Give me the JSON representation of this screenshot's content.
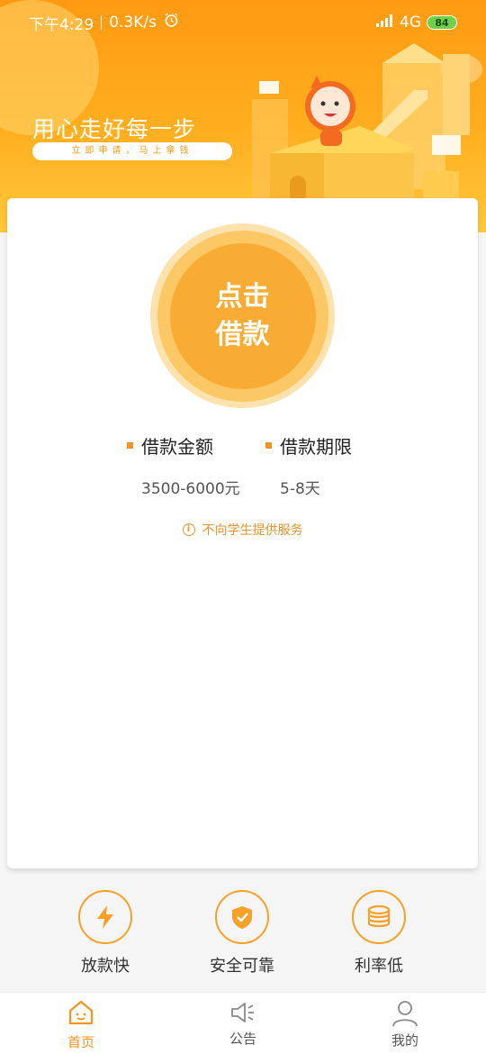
{
  "status_bar": {
    "time": "下午4:29",
    "speed": "0.3K/s",
    "network": "4G",
    "battery": "84"
  },
  "banner": {
    "slogan": "用心走好每一步",
    "subslogan": "立即申请，马上拿钱"
  },
  "loan_button": {
    "label": "点击\n借款"
  },
  "loan_info": {
    "amount_label": "借款金额",
    "amount_value": "3500-6000元",
    "term_label": "借款期限",
    "term_value": "5-8天"
  },
  "notice": {
    "text": "不向学生提供服务"
  },
  "features": [
    {
      "label": "放款快",
      "icon": "lightning-icon"
    },
    {
      "label": "安全可靠",
      "icon": "shield-check-icon"
    },
    {
      "label": "利率低",
      "icon": "coin-stack-icon"
    }
  ],
  "bottom_nav": [
    {
      "label": "首页",
      "icon": "home-icon",
      "active": true
    },
    {
      "label": "公告",
      "icon": "speaker-icon",
      "active": false
    },
    {
      "label": "我的",
      "icon": "user-icon",
      "active": false
    }
  ],
  "colors": {
    "brand": "#f7931e",
    "button_core": "#f9ac33",
    "notice": "#e8922a"
  }
}
